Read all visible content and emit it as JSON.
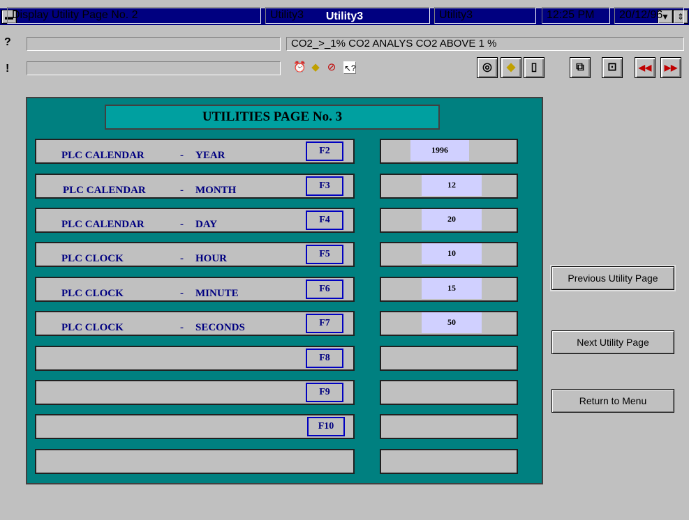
{
  "window": {
    "title": "Utility3"
  },
  "alarm_bar": {
    "help_mark": "?",
    "alert_mark": "!",
    "message": "CO2_>_1%  CO2 ANALYS CO2 ABOVE 1 %"
  },
  "alarm_icons": [
    "alarm-clock-icon",
    "warning-diamond-icon",
    "silence-icon",
    "help-pointer-icon"
  ],
  "toolbar": [
    {
      "name": "alarm-clock-icon",
      "glyph": "◎"
    },
    {
      "name": "warning-diamond-icon",
      "glyph": "◆"
    },
    {
      "name": "page-icon",
      "glyph": "▯"
    },
    {
      "name": "copy-icon",
      "glyph": "⧉"
    },
    {
      "name": "exit-icon",
      "glyph": "⊡"
    },
    {
      "name": "rewind-icon",
      "glyph": "◂◂"
    },
    {
      "name": "forward-icon",
      "glyph": "▸▸"
    }
  ],
  "panel": {
    "heading": "UTILITIES PAGE No. 3",
    "rows": [
      {
        "left": "PLC CALENDAR",
        "sep": "-",
        "right": "YEAR",
        "fkey": "F2",
        "value": "1996"
      },
      {
        "left": "PLC CALENDAR",
        "sep": "-",
        "right": "MONTH",
        "fkey": "F3",
        "value": "12"
      },
      {
        "left": "PLC CALENDAR",
        "sep": "-",
        "right": "DAY",
        "fkey": "F4",
        "value": "20"
      },
      {
        "left": "PLC CLOCK",
        "sep": "-",
        "right": "HOUR",
        "fkey": "F5",
        "value": "10"
      },
      {
        "left": "PLC CLOCK",
        "sep": "-",
        "right": "MINUTE",
        "fkey": "F6",
        "value": "15"
      },
      {
        "left": "PLC CLOCK",
        "sep": "-",
        "right": "SECONDS",
        "fkey": "F7",
        "value": "50"
      },
      {
        "left": "",
        "sep": "",
        "right": "",
        "fkey": "F8",
        "value": ""
      },
      {
        "left": "",
        "sep": "",
        "right": "",
        "fkey": "F9",
        "value": ""
      },
      {
        "left": "",
        "sep": "",
        "right": "",
        "fkey": "F10",
        "value": ""
      },
      {
        "left": "",
        "sep": "",
        "right": "",
        "fkey": "",
        "value": ""
      }
    ]
  },
  "buttons": {
    "previous": "Previous Utility Page",
    "next": "Next Utility Page",
    "return": "Return to Menu"
  },
  "statusbar": {
    "message": "Display Utility Page No. 2",
    "node1": "Utility3",
    "node2": "Utility3",
    "time": "12:25 PM",
    "date": "20/12/96"
  },
  "colors": {
    "title": "#000080",
    "panel": "#008080",
    "label": "#000080",
    "value_bg": "#d0d0ff"
  }
}
